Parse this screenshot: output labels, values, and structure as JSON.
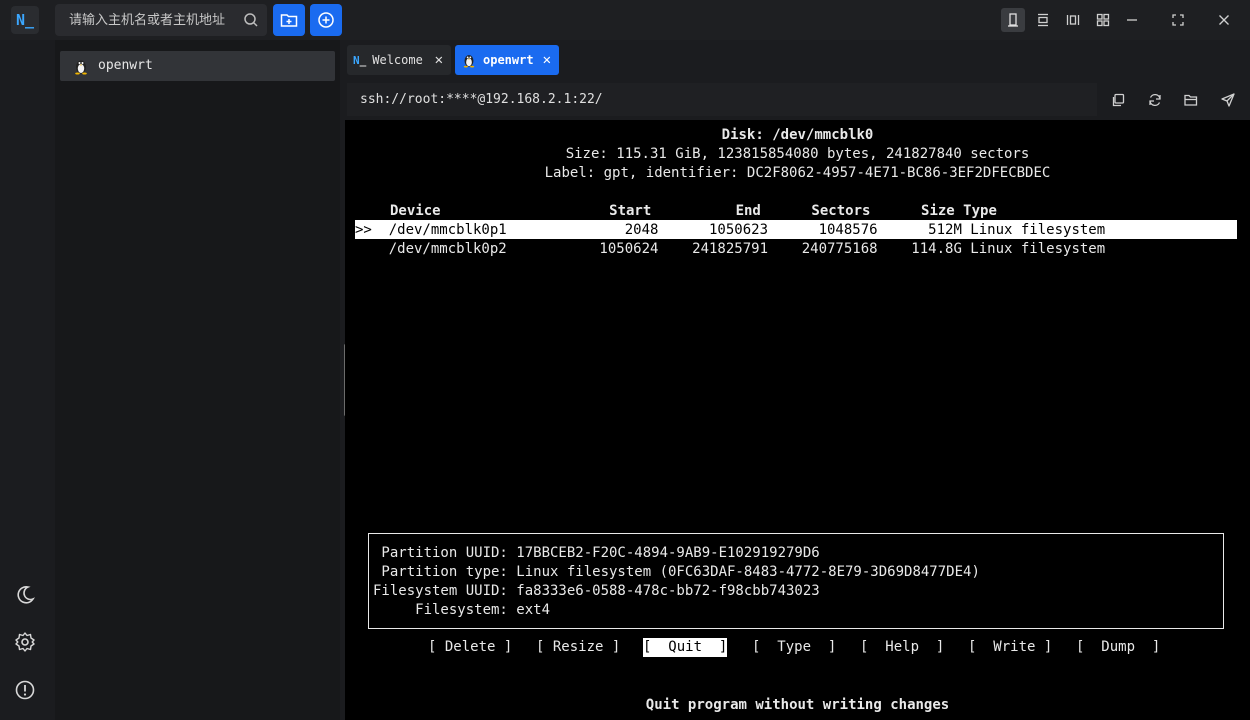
{
  "app": {
    "logo_text": "N_",
    "accent": "#1a6bf0"
  },
  "search": {
    "placeholder": "请输入主机名或者主机地址"
  },
  "sidebar": {
    "hosts": [
      {
        "label": "openwrt",
        "icon": "linux-tux-icon"
      }
    ]
  },
  "tabs": [
    {
      "label": "Welcome",
      "icon": "n-logo-icon",
      "active": false
    },
    {
      "label": "openwrt",
      "icon": "linux-tux-icon",
      "active": true
    }
  ],
  "address": {
    "url": "ssh://root:****@192.168.2.1:22/"
  },
  "terminal": {
    "disk_title": "Disk: /dev/mmcblk0",
    "disk_size": "Size: 115.31 GiB, 123815854080 bytes, 241827840 sectors",
    "disk_label": "Label: gpt, identifier: DC2F8062-4957-4E71-BC86-3EF2DFECBDEC",
    "table_header": "Device                    Start          End      Sectors      Size Type",
    "rows": [
      {
        "text": ">>  /dev/mmcblk0p1              2048      1050623      1048576      512M Linux filesystem",
        "selected": true
      },
      {
        "text": "    /dev/mmcblk0p2           1050624    241825791    240775168    114.8G Linux filesystem",
        "selected": false
      }
    ],
    "info_lines": [
      " Partition UUID: 17BBCEB2-F20C-4894-9AB9-E102919279D6",
      " Partition type: Linux filesystem (0FC63DAF-8483-4772-8E79-3D69D8477DE4)",
      "Filesystem UUID: fa8333e6-0588-478c-bb72-f98cbb743023",
      "     Filesystem: ext4"
    ],
    "menu": [
      "[ Delete ]",
      "[ Resize ]",
      "[  Quit  ]",
      "[  Type  ]",
      "[  Help  ]",
      "[  Write ]",
      "[  Dump  ]"
    ],
    "menu_selected": 2,
    "hint": "Quit program without writing changes"
  }
}
